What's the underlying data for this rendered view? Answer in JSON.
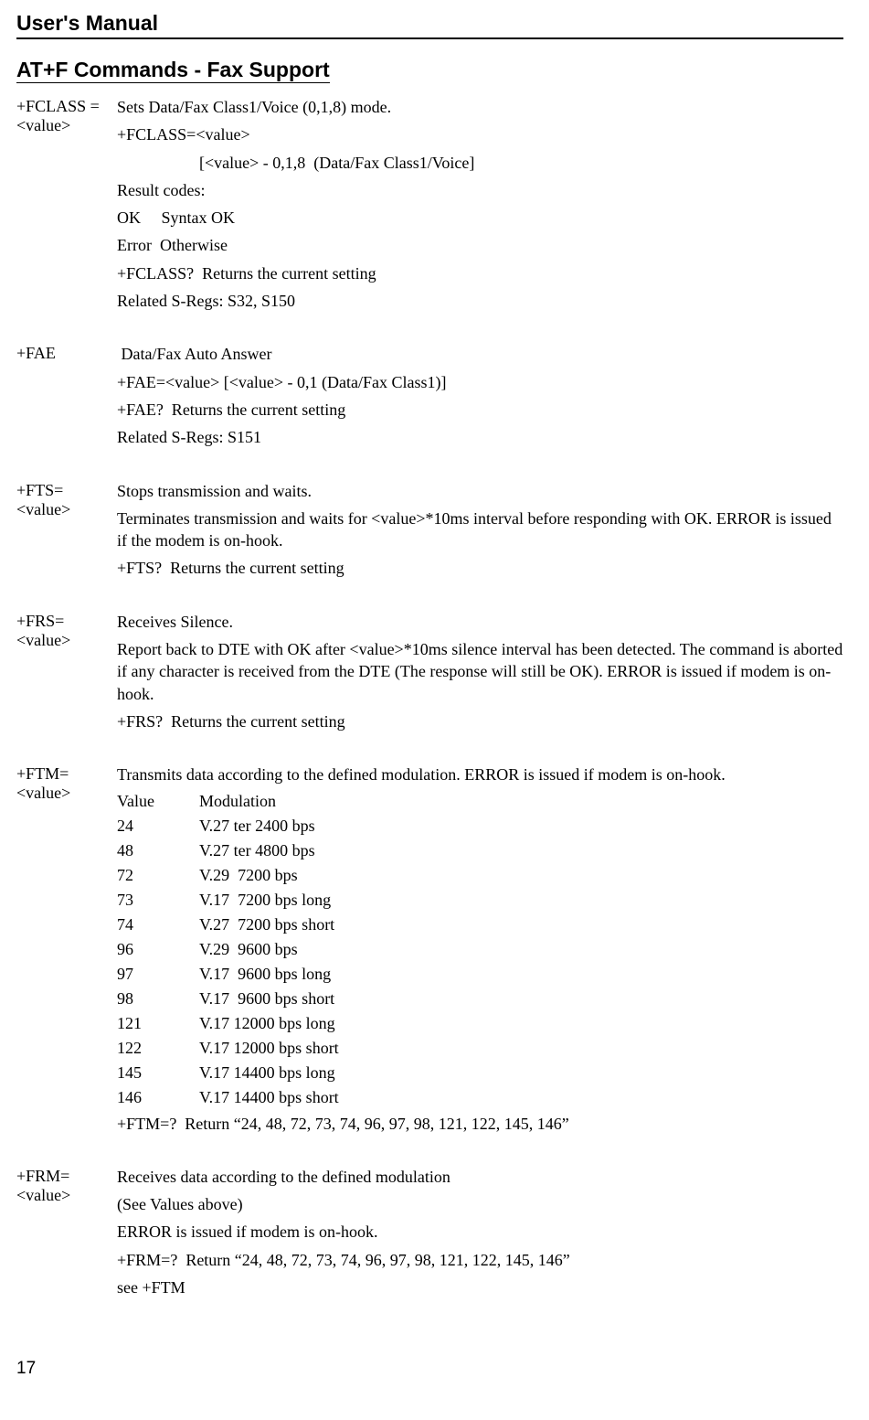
{
  "header": "User's Manual",
  "heading": "AT+F Commands - Fax Support",
  "page_number": "17",
  "commands": [
    {
      "name": "+FCLASS =<value>",
      "lines": [
        "Sets Data/Fax Class1/Voice (0,1,8) mode.",
        "+FCLASS=<value>",
        "Result codes:",
        "OK  Syntax OK",
        "Error  Otherwise",
        "+FCLASS?  Returns the current setting",
        "Related S-Regs: S32, S150"
      ],
      "indent_after_1": "[<value> - 0,1,8  (Data/Fax Class1/Voice]"
    },
    {
      "name": "+FAE",
      "lines": [
        " Data/Fax Auto Answer",
        "+FAE=<value> [<value> - 0,1 (Data/Fax Class1)]",
        "+FAE?  Returns the current setting",
        "Related S-Regs: S151"
      ]
    },
    {
      "name": "+FTS= <value>",
      "lines": [
        "Stops transmission and waits.",
        "Terminates transmission and waits for <value>*10ms interval before responding with OK. ERROR is issued if the modem is on-hook.",
        "+FTS?  Returns the current setting"
      ]
    },
    {
      "name": "+FRS= <value>",
      "lines": [
        "Receives Silence.",
        "Report back to DTE with OK after <value>*10ms silence interval has been detected. The command is aborted if any character is received from the DTE (The response will still be OK). ERROR is issued if modem is on-hook.",
        "+FRS?  Returns the current setting"
      ]
    },
    {
      "name": "+FTM= <value>",
      "intro": "Transmits data according to the defined modulation. ERROR is issued if modem is on-hook.",
      "mod_header": {
        "v": "Value",
        "m": "Modulation"
      },
      "mods": [
        {
          "v": "24",
          "m": "V.27 ter 2400 bps"
        },
        {
          "v": "48",
          "m": "V.27 ter 4800 bps"
        },
        {
          "v": "72",
          "m": "V.29  7200 bps"
        },
        {
          "v": "73",
          "m": "V.17  7200 bps long"
        },
        {
          "v": "74",
          "m": "V.27  7200 bps short"
        },
        {
          "v": "96",
          "m": "V.29  9600 bps"
        },
        {
          "v": "97",
          "m": "V.17  9600 bps long"
        },
        {
          "v": "98",
          "m": "V.17  9600 bps short"
        },
        {
          "v": "121",
          "m": "V.17 12000 bps long"
        },
        {
          "v": "122",
          "m": "V.17 12000 bps short"
        },
        {
          "v": "145",
          "m": "V.17 14400 bps long"
        },
        {
          "v": "146",
          "m": "V.17 14400 bps short"
        }
      ],
      "return_line": "+FTM=?  Return “24, 48, 72, 73, 74, 96, 97, 98, 121, 122, 145, 146”"
    },
    {
      "name": "+FRM= <value>",
      "lines": [
        "Receives data according to the defined modulation",
        "(See Values above)",
        "ERROR is issued if modem is on-hook.",
        "+FRM=?  Return “24, 48, 72, 73, 74, 96, 97, 98, 121, 122, 145, 146”",
        "see +FTM"
      ]
    }
  ]
}
